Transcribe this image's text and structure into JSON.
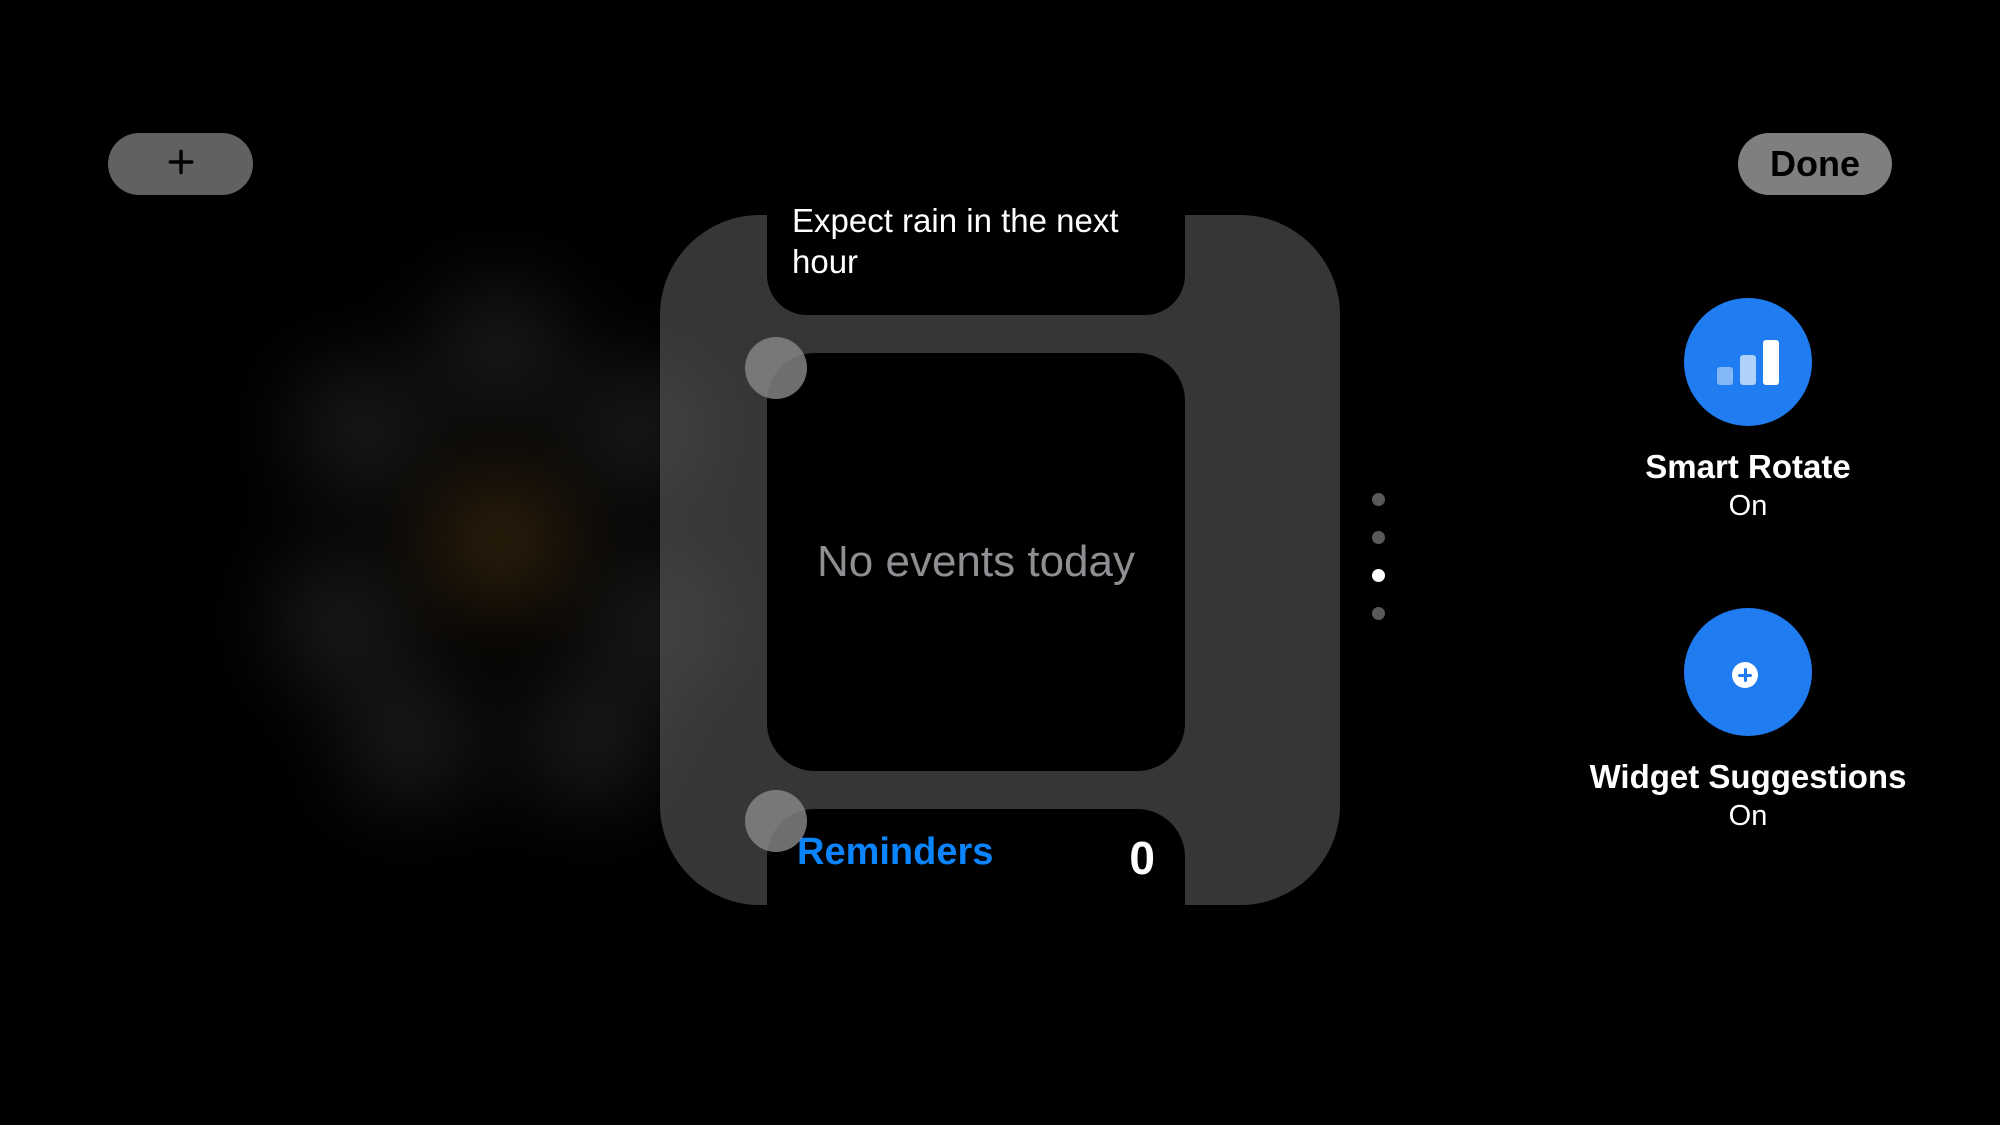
{
  "header": {
    "done_label": "Done"
  },
  "stack": {
    "weather_text": "Expect rain in the next hour",
    "calendar_text": "No events today",
    "reminders_label": "Reminders",
    "reminders_count": "0"
  },
  "pager": {
    "total": 4,
    "active_index": 2
  },
  "options": {
    "smart_rotate": {
      "title": "Smart Rotate",
      "status": "On"
    },
    "widget_suggestions": {
      "title": "Widget Suggestions",
      "status": "On"
    }
  }
}
